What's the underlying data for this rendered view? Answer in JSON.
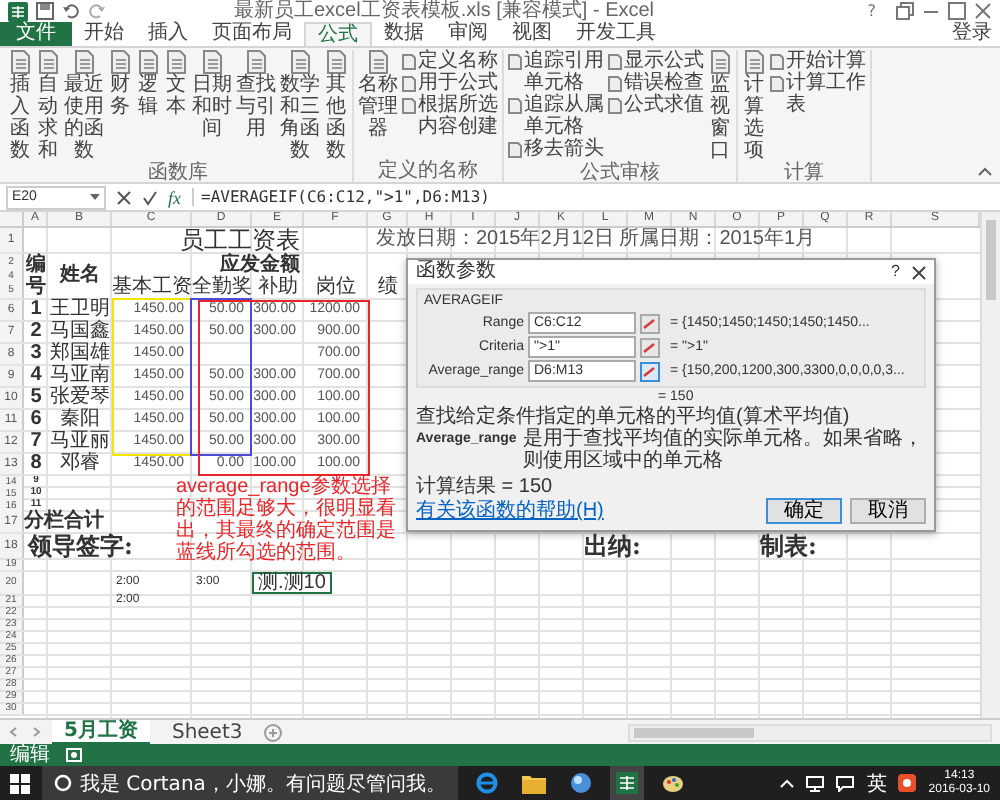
{
  "title_bar": {
    "title": "最新员工excel工资表模板.xls [兼容模式] - Excel",
    "help": "?"
  },
  "ribbon_tabs": [
    {
      "label": "文件",
      "kind": "file",
      "selected": false
    },
    {
      "label": "开始",
      "kind": "tab",
      "selected": false
    },
    {
      "label": "插入",
      "kind": "tab",
      "selected": false
    },
    {
      "label": "页面布局",
      "kind": "tab",
      "selected": false
    },
    {
      "label": "公式",
      "kind": "tab",
      "selected": true
    },
    {
      "label": "数据",
      "kind": "tab",
      "selected": false
    },
    {
      "label": "审阅",
      "kind": "tab",
      "selected": false
    },
    {
      "label": "视图",
      "kind": "tab",
      "selected": false
    },
    {
      "label": "开发工具",
      "kind": "tab",
      "selected": false
    }
  ],
  "account": "登录",
  "ribbon_groups": [
    {
      "label": "函数库",
      "columns": [
        [
          {
            "label": "插入函数",
            "kind": "large"
          }
        ],
        [
          {
            "label": "自动求和",
            "kind": "large"
          }
        ],
        [
          {
            "label": "最近使用的函数",
            "kind": "large"
          }
        ],
        [
          {
            "label": "财务",
            "kind": "large"
          }
        ],
        [
          {
            "label": "逻辑",
            "kind": "large"
          }
        ],
        [
          {
            "label": "文本",
            "kind": "large"
          }
        ],
        [
          {
            "label": "日期和时间",
            "kind": "large"
          }
        ],
        [
          {
            "label": "查找与引用",
            "kind": "large"
          }
        ],
        [
          {
            "label": "数学和三角函数",
            "kind": "large"
          }
        ],
        [
          {
            "label": "其他函数",
            "kind": "large"
          }
        ]
      ]
    },
    {
      "label": "定义的名称",
      "columns": [
        [
          {
            "label": "名称管理器",
            "kind": "large"
          }
        ],
        [
          {
            "label": "定义名称",
            "kind": "small"
          },
          {
            "label": "用于公式",
            "kind": "small"
          },
          {
            "label": "根据所选内容创建",
            "kind": "small"
          }
        ]
      ]
    },
    {
      "label": "公式审核",
      "columns": [
        [
          {
            "label": "追踪引用单元格",
            "kind": "small"
          },
          {
            "label": "追踪从属单元格",
            "kind": "small"
          },
          {
            "label": "移去箭头",
            "kind": "small"
          }
        ],
        [
          {
            "label": "显示公式",
            "kind": "small"
          },
          {
            "label": "错误检查",
            "kind": "small"
          },
          {
            "label": "公式求值",
            "kind": "small"
          }
        ],
        [
          {
            "label": "监视窗口",
            "kind": "large"
          }
        ]
      ]
    },
    {
      "label": "计算",
      "columns": [
        [
          {
            "label": "计算选项",
            "kind": "large"
          }
        ],
        [
          {
            "label": "开始计算",
            "kind": "small"
          },
          {
            "label": "计算工作表",
            "kind": "small"
          }
        ]
      ]
    }
  ],
  "formula_bar": {
    "name_box": "E20",
    "fx": "fx",
    "formula": "=AVERAGEIF(C6:C12,\">1\",D6:M13)"
  },
  "columns": [
    "A",
    "B",
    "C",
    "D",
    "E",
    "F",
    "G",
    "H",
    "I",
    "J",
    "K",
    "L",
    "M",
    "N",
    "O",
    "P",
    "Q",
    "R",
    "S"
  ],
  "sheet": {
    "title_row": "1",
    "title": "员工工资表",
    "date_info": "发放日期：2015年2月12日 所属日期：2015年1月",
    "header": {
      "rows": [
        "2",
        "4",
        "5"
      ],
      "number": "编号",
      "name": "姓名",
      "group": "应发金额",
      "columns": [
        "基本工资",
        "全勤奖",
        "补助",
        "岗位",
        "绩"
      ]
    },
    "rows": [
      {
        "row": "6",
        "no": "1",
        "name": "王卫明",
        "base_pay": "1450.00",
        "attendance_bonus": "50.00",
        "allowance": "300.00",
        "post_pay": "1200.00"
      },
      {
        "row": "7",
        "no": "2",
        "name": "马国鑫",
        "base_pay": "1450.00",
        "attendance_bonus": "50.00",
        "allowance": "300.00",
        "post_pay": "900.00"
      },
      {
        "row": "8",
        "no": "3",
        "name": "郑国雄",
        "base_pay": "1450.00",
        "post_pay": "700.00"
      },
      {
        "row": "9",
        "no": "4",
        "name": "马亚南",
        "base_pay": "1450.00",
        "attendance_bonus": "50.00",
        "allowance": "300.00",
        "post_pay": "700.00"
      },
      {
        "row": "10",
        "no": "5",
        "name": "张爱琴",
        "base_pay": "1450.00",
        "attendance_bonus": "50.00",
        "allowance": "300.00",
        "post_pay": "100.00"
      },
      {
        "row": "11",
        "no": "6",
        "name": "秦阳",
        "base_pay": "1450.00",
        "attendance_bonus": "50.00",
        "allowance": "300.00",
        "post_pay": "100.00"
      },
      {
        "row": "12",
        "no": "7",
        "name": "马亚丽",
        "base_pay": "1450.00",
        "attendance_bonus": "50.00",
        "allowance": "300.00",
        "post_pay": "300.00"
      },
      {
        "row": "13",
        "no": "8",
        "name": "邓睿",
        "base_pay": "1450.00",
        "attendance_bonus": "0.00",
        "allowance": "100.00",
        "post_pay": "100.00"
      }
    ],
    "frames": [
      {
        "color": "#f5e400"
      },
      {
        "color": "#4b4bd6"
      },
      {
        "color": "#e8262a"
      }
    ],
    "extra_rows": [
      {
        "row": "14",
        "no": "9"
      },
      {
        "row": "15",
        "no": "10"
      },
      {
        "row": "16",
        "no": "11"
      }
    ],
    "total": {
      "row": "17",
      "label": "分栏合计"
    },
    "sign": {
      "row": "18",
      "labels": [
        "领导签字:",
        "出纳:",
        "制表:"
      ]
    },
    "lower_rows": [
      {
        "row": "19"
      },
      {
        "row": "20",
        "cells": [
          {
            "text": "2:00",
            "selected": false
          },
          {
            "text": "3:00",
            "selected": false
          },
          {
            "text": "测.测10",
            "selected": true
          }
        ]
      },
      {
        "row": "21",
        "cells": [
          {
            "text": "2:00",
            "selected": false
          }
        ]
      },
      {
        "row": "22"
      },
      {
        "row": "23"
      },
      {
        "row": "24"
      },
      {
        "row": "25"
      },
      {
        "row": "26"
      },
      {
        "row": "27"
      },
      {
        "row": "28"
      },
      {
        "row": "29"
      },
      {
        "row": "30"
      }
    ],
    "annotation": "average_range参数选择的范围足够大，很明显看出，其最终的确定范围是蓝线所勾选的范围。"
  },
  "dialog": {
    "title": "函数参数",
    "help": "?",
    "function": "AVERAGEIF",
    "args": [
      {
        "label": "Range",
        "value": "C6:C12",
        "result": "= {1450;1450;1450;1450;1450...",
        "focused": false
      },
      {
        "label": "Criteria",
        "value": "\">1\"",
        "result": "= \">1\"",
        "focused": false
      },
      {
        "label": "Average_range",
        "value": "D6:M13",
        "result": "= {150,200,1200,300,3300,0,0,0,0,3...",
        "focused": true
      }
    ],
    "total": "= 150",
    "description": "查找给定条件指定的单元格的平均值(算术平均值)",
    "arg_name": "Average_range",
    "arg_help": "是用于查找平均值的实际单元格。如果省略，则使用区域中的单元格",
    "result": "计算结果 = 150",
    "help_link": "有关该函数的帮助(H)",
    "ok": "确定",
    "cancel": "取消"
  },
  "sheet_tabs": [
    {
      "label": "5月工资",
      "selected": true
    },
    {
      "label": "Sheet3",
      "selected": false
    }
  ],
  "status": "编辑",
  "taskbar": {
    "search": "我是 Cortana，小娜。有问题尽管问我。",
    "ime": "英",
    "time": "14:13",
    "date": "2016-03-10"
  }
}
